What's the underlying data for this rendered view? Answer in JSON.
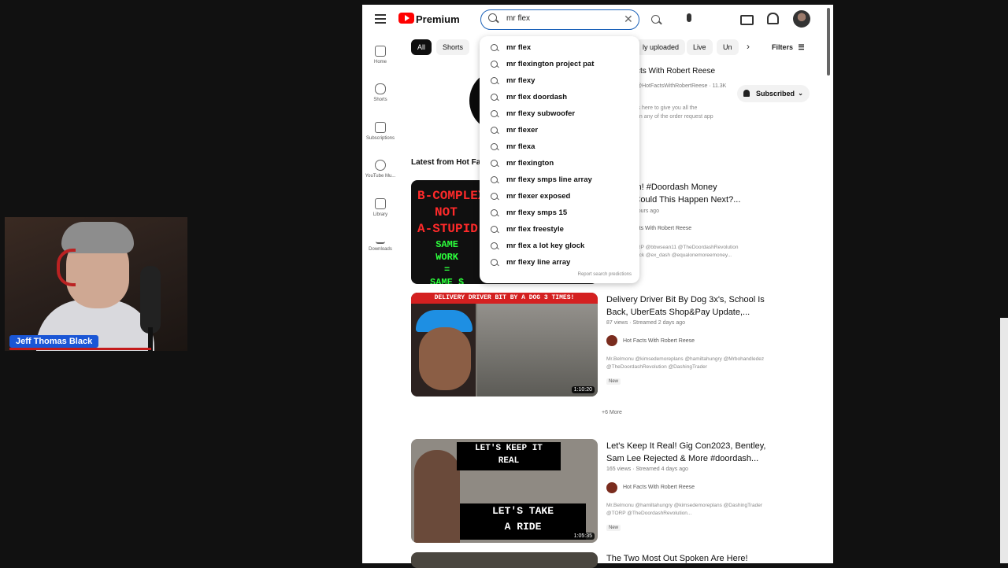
{
  "webcam": {
    "name_label": "Jeff Thomas Black"
  },
  "header": {
    "brand": "Premium",
    "search_value": "mr flex",
    "clear_glyph": "✕"
  },
  "sidebar": {
    "items": [
      {
        "label": "Home",
        "icon": "home-icon"
      },
      {
        "label": "Shorts",
        "icon": "shorts-icon"
      },
      {
        "label": "Subscriptions",
        "icon": "subscriptions-icon"
      },
      {
        "label": "YouTube Mu...",
        "icon": "youtube-music-icon"
      },
      {
        "label": "Library",
        "icon": "library-icon"
      },
      {
        "label": "Downloads",
        "icon": "downloads-icon"
      }
    ]
  },
  "chips": [
    "All",
    "Shorts",
    "ly uploaded",
    "Live",
    "Un"
  ],
  "chip_arrow": "›",
  "filters_label": "Filters",
  "channel": {
    "name": "cts With Robert Reese",
    "sub_line": "@HotFactsWithRobertReese · 11.3K",
    "desc_line1": "is here to give you all the",
    "desc_line2": "on any of the order request app",
    "subscribed_label": "Subscribed"
  },
  "section_title": "Latest from Hot Fa",
  "suggestions": [
    "mr flex",
    "mr flexington project pat",
    "mr flexy",
    "mr flex doordash",
    "mr flexy subwoofer",
    "mr flexer",
    "mr flexa",
    "mr flexington",
    "mr flexy smps line array",
    "mr flexer exposed",
    "mr flexy smps 15",
    "mr flex freestyle",
    "mr flex a lot key glock",
    "mr flexy line array"
  ],
  "report_label": "Report search predictions",
  "videos": [
    {
      "thumb_line1": "B-COMPLEX",
      "thumb_line2": "NOT",
      "thumb_line3": "A-STUPID",
      "thumb_line4": "SAME",
      "thumb_line5": "WORK",
      "thumb_line6": "=",
      "thumb_line7": "SAME $",
      "title_l1": "me Is On! #Doordash Money",
      "title_l2": "ulation Could This Happen Next?...",
      "meta": "7 hours ago",
      "channel": "Facts With Robert Reese",
      "desc_l1": "TORP @bbwsean11 @TheDoordashRevolution",
      "desc_l2": "dBack @ex_dash @equalonemoreemoney..."
    },
    {
      "banner": "DELIVERY DRIVER BIT BY A DOG 3 TIMES!",
      "duration": "1:10:20",
      "title_l1": "Delivery Driver Bit By Dog 3x's, School Is",
      "title_l2": "Back, UberEats Shop&Pay Update,...",
      "meta": "87 views · Streamed 2 days ago",
      "channel": "Hot Facts With Robert Reese",
      "desc_l1": "Mr.Belmonu @kimsedemoreplans @hamiltahungry @Mrbohandledez",
      "desc_l2": "@TheDoordashRevolution @DashingTrader",
      "badge": "New"
    },
    {
      "sign1_l1": "LET'S KEEP IT",
      "sign1_l2": "REAL",
      "sign2_l1": "LET'S TAKE",
      "sign2_l2": "A RIDE",
      "duration": "1:05:35",
      "title_l1": "Let's Keep It Real! Gig Con2023, Bentley,",
      "title_l2": "Sam Lee Rejected & More #doordash...",
      "meta": "165 views · Streamed 4 days ago",
      "channel": "Hot Facts With Robert Reese",
      "desc_l1": "Mr.Belmonu @hamiltahungry @kimsedemoreplans @DashingTrader",
      "desc_l2": "@TORP @TheDoordashRevolution...",
      "badge": "New"
    },
    {
      "title_l1": "The Two Most Out Spoken Are Here!"
    }
  ],
  "more_label": "+6 More"
}
